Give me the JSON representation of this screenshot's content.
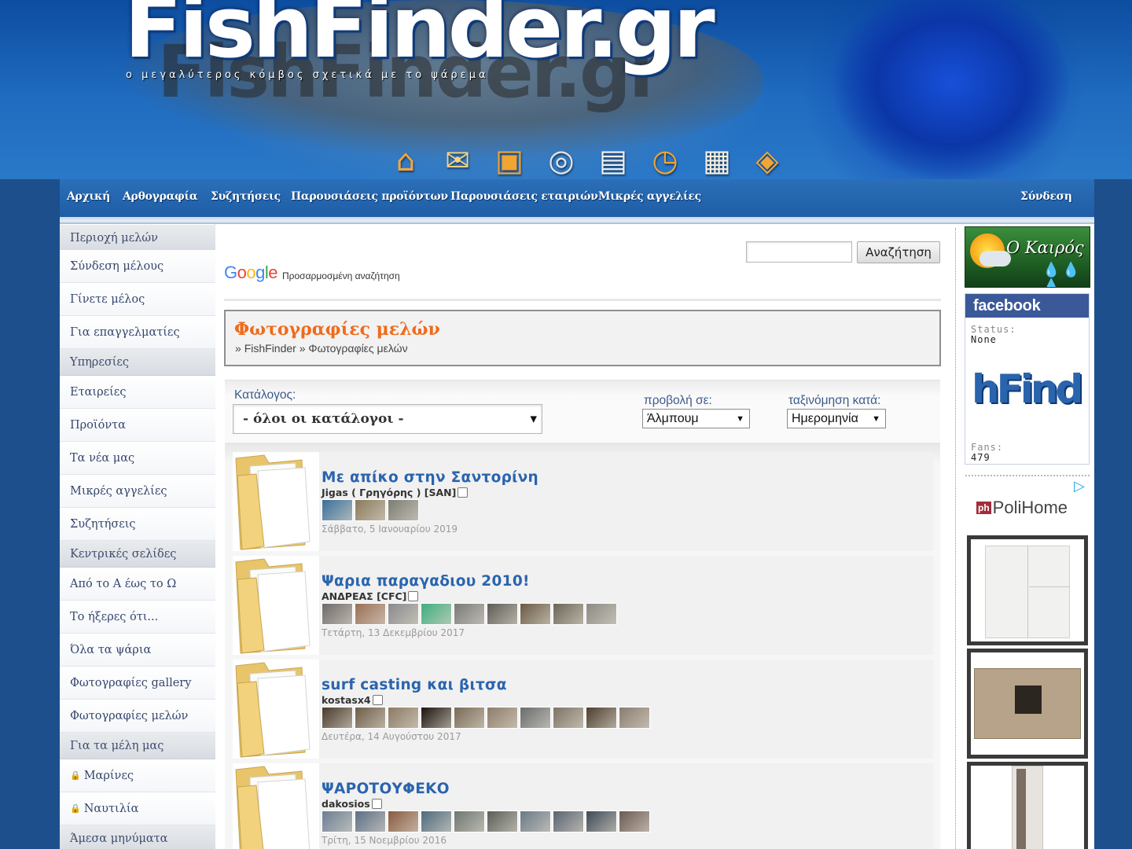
{
  "header": {
    "logo": "FishFinder.gr",
    "logo_ghost": "FishFinder.gr",
    "tagline": "ο μεγαλύτερος κόμβος σχετικά με το ψάρεμα",
    "icons": [
      "home-icon",
      "mail-icon",
      "shopping-bag-icon",
      "cd-icon",
      "clapperboard-icon",
      "clock-icon",
      "calendar-icon",
      "tag-icon"
    ]
  },
  "nav": {
    "items": [
      "Αρχική",
      "Αρθογραφία",
      "Συζητήσεις",
      "Παρουσιάσεις προϊόντων",
      "Παρουσιάσεις εταιριών",
      "Μικρές αγγελίες"
    ],
    "login": "Σύνδεση"
  },
  "sidebar": {
    "sections": [
      {
        "heading": "Περιοχή μελών",
        "items": [
          "Σύνδεση μέλους",
          "Γίνετε μέλος",
          "Για επαγγελματίες"
        ]
      },
      {
        "heading": "Υπηρεσίες",
        "items": [
          "Εταιρείες",
          "Προϊόντα",
          "Τα νέα μας",
          "Μικρές αγγελίες",
          "Συζητήσεις"
        ]
      },
      {
        "heading": "Κεντρικές σελίδες",
        "items": [
          "Από το Α έως το Ω",
          "Το ήξερες ότι...",
          "Όλα τα ψάρια",
          "Φωτογραφίες gallery",
          "Φωτογραφίες μελών"
        ]
      },
      {
        "heading": "Για τα μέλη μας",
        "items": [
          "Μαρίνες",
          "Ναυτιλία"
        ]
      },
      {
        "heading": "Άμεσα μηνύματα",
        "items": []
      }
    ],
    "lock_symbol": "🔒"
  },
  "search": {
    "value": "",
    "button": "Αναζήτηση",
    "google_letters": [
      "G",
      "o",
      "o",
      "g",
      "l",
      "e"
    ],
    "google_caption": "Προσαρμοσμένη αναζήτηση"
  },
  "page": {
    "title": "Φωτογραφίες μελών",
    "breadcrumb": [
      "FishFinder",
      "Φωτογραφίες μελών"
    ],
    "breadcrumb_sep": "»"
  },
  "filters": {
    "catalog_label": "Κατάλογος:",
    "catalog_value": "- όλοι οι κατάλογοι -",
    "view_label": "προβολή σε:",
    "view_value": "Άλμπουμ",
    "sort_label": "ταξινόμηση κατά:",
    "sort_value": "Ημερομηνία"
  },
  "albums": [
    {
      "title": "Με απίκο στην Σαντορίνη",
      "author": "Jigas ( Γρηγόρης ) [SAN]",
      "date": "Σάββατο, 5 Ιανουαρίου 2019",
      "thumb_colors": [
        "#3b6f9a",
        "#8a7a5c",
        "#7c7c74"
      ]
    },
    {
      "title": "Ψαρια παραγαδιου 2010!",
      "author": "ΑΝΔΡΕΑΣ [CFC]",
      "date": "Τετάρτη, 13 Δεκεμβρίου 2017",
      "thumb_colors": [
        "#6e6a6a",
        "#9a6f55",
        "#8a8a8c",
        "#3fae7f",
        "#7a7a78",
        "#5d5c55",
        "#6a5a44",
        "#6c6656",
        "#8c8a84"
      ]
    },
    {
      "title": "surf casting και βιτσα",
      "author": "kostasx4",
      "date": "Δευτέρα, 14 Αυγούστου 2017",
      "thumb_colors": [
        "#4a3a2c",
        "#6e5c48",
        "#8c7a64",
        "#1a140e",
        "#7a6a56",
        "#8e7c6a",
        "#6a6c6e",
        "#7e7466",
        "#4e3e2e",
        "#8a7c70"
      ]
    },
    {
      "title": "ΨΑΡΟΤΟΥΦΕΚΟ",
      "author": "dakosios",
      "date": "Τρίτη, 15 Νοεμβρίου 2016",
      "thumb_colors": [
        "#6a7e94",
        "#5c6e86",
        "#8a5a3e",
        "#4e6a7e",
        "#6e7672",
        "#5a5e58",
        "#6a7a86",
        "#5a6470",
        "#3e4a56",
        "#6c5a52"
      ]
    }
  ],
  "right": {
    "weather_label": "Ο Καιρός",
    "weather_drops": "💧💧💧",
    "fb_label": "facebook",
    "fb_status_label": "Status:",
    "fb_status": "None",
    "fb_brand": "hFind",
    "fb_fans_label": "Fans:",
    "fb_fans": "479",
    "ad_logo": "ph",
    "ad_brand": "PoliHome",
    "ad_play": "▷"
  }
}
